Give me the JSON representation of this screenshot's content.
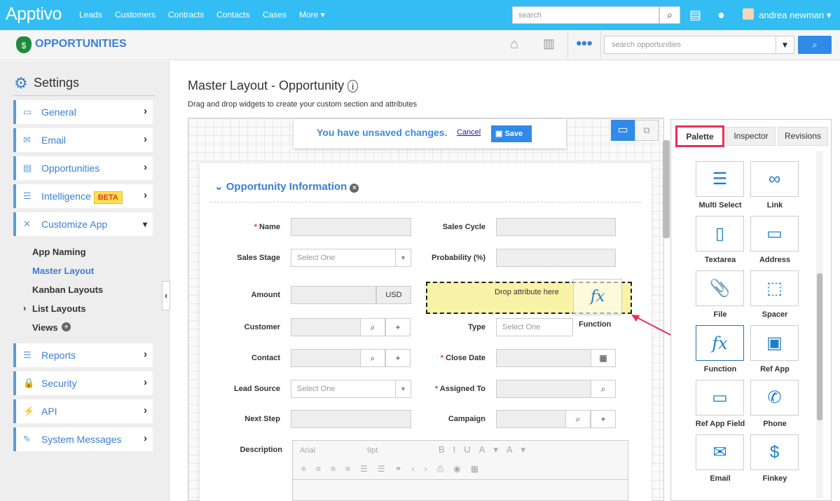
{
  "topbar": {
    "logo": "Apptivo",
    "nav": [
      "Leads",
      "Customers",
      "Contracts",
      "Contacts",
      "Cases",
      "More ▾"
    ],
    "search_placeholder": "search",
    "user": "andrea newman"
  },
  "app": {
    "title": "OPPORTUNITIES",
    "search_placeholder": "search opportunities"
  },
  "sidebar": {
    "title": "Settings",
    "items": [
      {
        "label": "General",
        "icon": "monitor-icon"
      },
      {
        "label": "Email",
        "icon": "envelope-icon"
      },
      {
        "label": "Opportunities",
        "icon": "card-icon"
      },
      {
        "label": "Intelligence",
        "icon": "chart-icon",
        "badge": "BETA"
      },
      {
        "label": "Customize App",
        "icon": "tools-icon"
      }
    ],
    "sub_items": [
      "App Naming",
      "Master Layout",
      "Kanban Layouts",
      "List Layouts",
      "Views"
    ],
    "items2": [
      {
        "label": "Reports",
        "icon": "report-icon"
      },
      {
        "label": "Security",
        "icon": "lock-icon"
      },
      {
        "label": "API",
        "icon": "plug-icon"
      },
      {
        "label": "System Messages",
        "icon": "message-icon"
      }
    ]
  },
  "main": {
    "title": "Master Layout - Opportunity",
    "subtitle": "Drag and drop widgets to create your custom section and attributes",
    "unsaved": "You have unsaved changes.",
    "cancel": "Cancel",
    "save": "Save",
    "section": "Opportunity Information",
    "fields": {
      "name": "Name",
      "sales_cycle": "Sales Cycle",
      "sales_stage": "Sales Stage",
      "select_one": "Select One",
      "probability": "Probability (%)",
      "amount": "Amount",
      "currency": "USD",
      "drop": "Drop attribute here",
      "customer": "Customer",
      "type": "Type",
      "contact": "Contact",
      "close_date": "Close Date",
      "lead_source": "Lead Source",
      "assigned_to": "Assigned To",
      "next_step": "Next Step",
      "campaign": "Campaign",
      "description": "Description",
      "font": "Arial",
      "size": "9pt",
      "function_drag": "Function"
    }
  },
  "palette": {
    "tabs": [
      "Palette",
      "Inspector",
      "Revisions"
    ],
    "active_tab": "Palette",
    "items": [
      {
        "label": "Multi Select",
        "icon": "checklist-icon",
        "glyph": "☰"
      },
      {
        "label": "Link",
        "icon": "link-icon",
        "glyph": "∞"
      },
      {
        "label": "Textarea",
        "icon": "textarea-icon",
        "glyph": "▯"
      },
      {
        "label": "Address",
        "icon": "address-icon",
        "glyph": "▭"
      },
      {
        "label": "File",
        "icon": "paperclip-icon",
        "glyph": "📎"
      },
      {
        "label": "Spacer",
        "icon": "spacer-icon",
        "glyph": "⬚"
      },
      {
        "label": "Function",
        "icon": "function-icon",
        "glyph": "fx"
      },
      {
        "label": "Ref App",
        "icon": "ref-app-icon",
        "glyph": "▣"
      },
      {
        "label": "Ref App Field",
        "icon": "ref-app-field-icon",
        "glyph": "▭"
      },
      {
        "label": "Phone",
        "icon": "phone-icon",
        "glyph": "✆"
      },
      {
        "label": "Email",
        "icon": "email-icon",
        "glyph": "✉"
      },
      {
        "label": "Finkey",
        "icon": "finkey-icon",
        "glyph": "$"
      }
    ]
  },
  "colors": {
    "topbar": "#33bdf3",
    "accent": "#3a7fd5",
    "highlight": "#e8305a",
    "drop": "#f8f3a6"
  }
}
